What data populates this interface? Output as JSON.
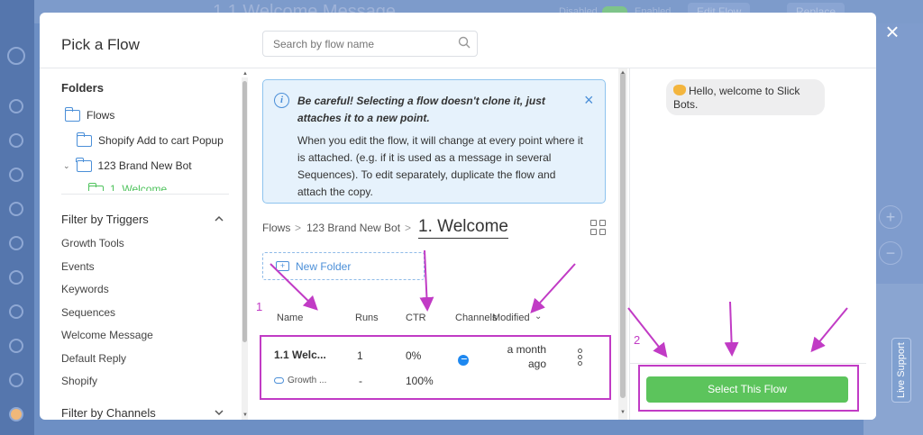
{
  "background": {
    "page_title": "1.1 Welcome Message",
    "toggle_disabled": "Disabled",
    "toggle_enabled": "Enabled",
    "edit_flow_label": "Edit Flow",
    "replace_label": "Replace",
    "zoom_in": "+",
    "zoom_out": "−",
    "live_support": "Live Support"
  },
  "modal": {
    "title": "Pick a Flow",
    "search_placeholder": "Search by flow name",
    "close_glyph": "×"
  },
  "folders": {
    "title": "Folders",
    "items": [
      {
        "label": "Flows",
        "level": 0
      },
      {
        "label": "Shopify Add to cart Popup",
        "level": 1
      },
      {
        "label": "123 Brand New Bot",
        "level": 1,
        "expanded": true
      },
      {
        "label": "1. Welcome",
        "level": 2,
        "active": true
      }
    ]
  },
  "triggers": {
    "title": "Filter by Triggers",
    "items": [
      "Growth Tools",
      "Events",
      "Keywords",
      "Sequences",
      "Welcome Message",
      "Default Reply",
      "Shopify"
    ]
  },
  "channels": {
    "title": "Filter by Channels"
  },
  "alert": {
    "bold_text": "Be careful! Selecting a flow doesn't clone it, just attaches it to a new point.",
    "body_text": "When you edit the flow, it will change at every point where it is attached. (e.g. if it is used as a message in several Sequences). To edit separately, duplicate the flow and attach the copy.",
    "close_glyph": "×"
  },
  "breadcrumb": {
    "items": [
      "Flows",
      "123 Brand New Bot"
    ],
    "current": "1. Welcome",
    "separator": ">"
  },
  "new_folder_label": "New Folder",
  "table": {
    "headers": {
      "name": "Name",
      "runs": "Runs",
      "ctr": "CTR",
      "channels": "Channels",
      "modified": "Modified"
    },
    "rows": [
      {
        "name": "1.1 Welc...",
        "runs": "1",
        "ctr": "0%",
        "modified": "a month ago",
        "sub_name": "Growth ...",
        "sub_runs": "-",
        "sub_ctr": "100%"
      }
    ]
  },
  "preview": {
    "message": "Hello, welcome to Slick Bots."
  },
  "select_button_label": "Select This Flow",
  "annotations": {
    "label_1": "1",
    "label_2": "2",
    "color": "#c13bc5"
  }
}
